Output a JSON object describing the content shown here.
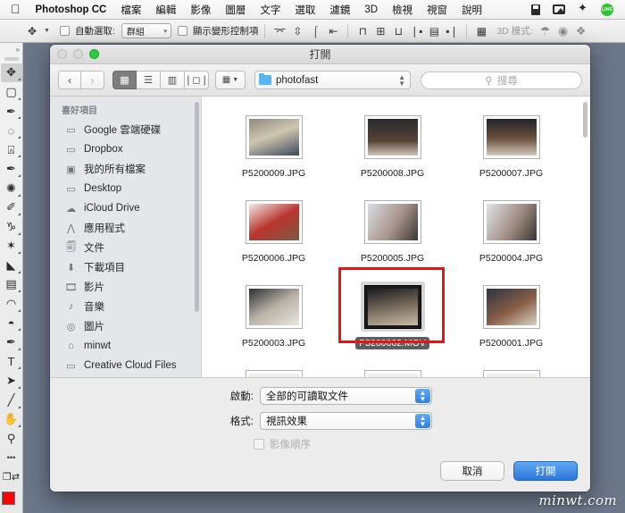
{
  "menubar": {
    "apple_icon": "apple-icon",
    "app_name": "Photoshop CC",
    "items": [
      "檔案",
      "編輯",
      "影像",
      "圖層",
      "文字",
      "選取",
      "濾鏡",
      "3D",
      "檢視",
      "視窗",
      "說明"
    ],
    "status_icons": [
      "disk-icon",
      "airplay-icon",
      "bluetooth-icon",
      "line-icon"
    ],
    "line_label": "LINE"
  },
  "options_bar": {
    "tool_icon": "move-tool-icon",
    "auto_select_label": "自動選取:",
    "auto_select_value": "群組",
    "show_transform_label": "顯示變形控制項",
    "align_icons": [
      "align-top-icon",
      "align-vertical-center-icon",
      "align-bottom-icon",
      "align-left-icon",
      "align-horizontal-center-icon",
      "align-right-icon",
      "distribute-icon"
    ],
    "mode_3d_label": "3D 模式:",
    "mode_3d_icons": [
      "orbit-3d-icon",
      "roll-3d-icon",
      "pan-3d-icon"
    ]
  },
  "toolbar": {
    "collapse_icon": "collapse-panel-icon",
    "tools": [
      {
        "name": "move-tool",
        "glyph": "✥",
        "active": true
      },
      {
        "name": "marquee-tool",
        "glyph": "▭",
        "active": false
      },
      {
        "name": "lasso-tool",
        "glyph": "✑",
        "active": false
      },
      {
        "name": "quick-selection-tool",
        "glyph": "◍",
        "active": false
      },
      {
        "name": "crop-tool",
        "glyph": "⌗",
        "active": false
      },
      {
        "name": "eyedropper-tool",
        "glyph": "✎",
        "active": false
      },
      {
        "name": "healing-brush-tool",
        "glyph": "✧",
        "active": false
      },
      {
        "name": "brush-tool",
        "glyph": "✐",
        "active": false
      },
      {
        "name": "clone-stamp-tool",
        "glyph": "♁",
        "active": false
      },
      {
        "name": "history-brush-tool",
        "glyph": "✦",
        "active": false
      },
      {
        "name": "eraser-tool",
        "glyph": "◣",
        "active": false
      },
      {
        "name": "gradient-tool",
        "glyph": "▤",
        "active": false
      },
      {
        "name": "blur-tool",
        "glyph": "◐",
        "active": false
      },
      {
        "name": "dodge-tool",
        "glyph": "◓",
        "active": false
      },
      {
        "name": "pen-tool",
        "glyph": "✒",
        "active": false
      },
      {
        "name": "type-tool",
        "glyph": "T",
        "active": false
      },
      {
        "name": "path-selection-tool",
        "glyph": "➤",
        "active": false
      },
      {
        "name": "shape-tool",
        "glyph": "╱",
        "active": false
      },
      {
        "name": "hand-tool",
        "glyph": "✋",
        "active": false
      },
      {
        "name": "zoom-tool",
        "glyph": "🔍",
        "active": false
      },
      {
        "name": "more-tools",
        "glyph": "•••",
        "active": false
      },
      {
        "name": "screen-mode",
        "glyph": "❐",
        "active": false
      }
    ],
    "foreground_color": "#fe0000",
    "background_color": "#ffffff"
  },
  "dialog": {
    "title": "打開",
    "traffic_lights": [
      "close-button",
      "minimize-button",
      "zoom-button"
    ],
    "nav": {
      "back_icon": "chevron-left-icon",
      "forward_icon": "chevron-right-icon"
    },
    "view_modes": [
      {
        "name": "icon-view",
        "glyph": "▩",
        "active": true
      },
      {
        "name": "list-view",
        "glyph": "☰",
        "active": false
      },
      {
        "name": "column-view",
        "glyph": "▥",
        "active": false
      },
      {
        "name": "coverflow-view",
        "glyph": "❘◻❘",
        "active": false
      }
    ],
    "group_button": {
      "name": "arrange-by-button",
      "glyph": "▦",
      "caret": "▾"
    },
    "path_popup": {
      "folder_icon": "folder-icon",
      "value": "photofast",
      "stepper": "updown-stepper"
    },
    "search": {
      "icon": "search-icon",
      "placeholder": "搜尋",
      "value": ""
    },
    "sidebar": {
      "header": "喜好項目",
      "items": [
        {
          "label": "Google 雲端硬碟",
          "icon": "folder-icon",
          "glyph": "▭"
        },
        {
          "label": "Dropbox",
          "icon": "folder-icon",
          "glyph": "▭"
        },
        {
          "label": "我的所有檔案",
          "icon": "all-my-files-icon",
          "glyph": "▣"
        },
        {
          "label": "Desktop",
          "icon": "folder-icon",
          "glyph": "▭"
        },
        {
          "label": "iCloud Drive",
          "icon": "cloud-icon",
          "glyph": "☁"
        },
        {
          "label": "應用程式",
          "icon": "applications-icon",
          "glyph": "⋀"
        },
        {
          "label": "文件",
          "icon": "documents-icon",
          "glyph": "🗐"
        },
        {
          "label": "下載項目",
          "icon": "downloads-icon",
          "glyph": "⬇"
        },
        {
          "label": "影片",
          "icon": "movies-icon",
          "glyph": "🎞"
        },
        {
          "label": "音樂",
          "icon": "music-icon",
          "glyph": "♪"
        },
        {
          "label": "圖片",
          "icon": "pictures-icon",
          "glyph": "◎"
        },
        {
          "label": "minwt",
          "icon": "home-icon",
          "glyph": "⌂"
        },
        {
          "label": "Creative Cloud Files",
          "icon": "folder-icon",
          "glyph": "▭"
        }
      ]
    },
    "files": [
      {
        "name": "P5200009.JPG",
        "type": "image",
        "selected": false
      },
      {
        "name": "P5200008.JPG",
        "type": "image",
        "selected": false
      },
      {
        "name": "P5200007.JPG",
        "type": "image",
        "selected": false
      },
      {
        "name": "P5200006.JPG",
        "type": "image",
        "selected": false
      },
      {
        "name": "P5200005.JPG",
        "type": "image",
        "selected": false
      },
      {
        "name": "P5200004.JPG",
        "type": "image",
        "selected": false
      },
      {
        "name": "P5200003.JPG",
        "type": "image",
        "selected": false
      },
      {
        "name": "P5200002.MOV",
        "type": "video",
        "selected": true
      },
      {
        "name": "P5200001.JPG",
        "type": "image",
        "selected": false
      }
    ],
    "annotation": {
      "name": "red-highlight-box",
      "color": "#ee1111"
    },
    "footer": {
      "enable_label": "啟動:",
      "enable_value": "全部的可讀取文件",
      "format_label": "格式:",
      "format_value": "視訊效果",
      "image_sequence_label": "影像順序",
      "image_sequence_checked": false,
      "cancel_label": "取消",
      "open_label": "打開"
    }
  },
  "watermark": "minwt.com"
}
